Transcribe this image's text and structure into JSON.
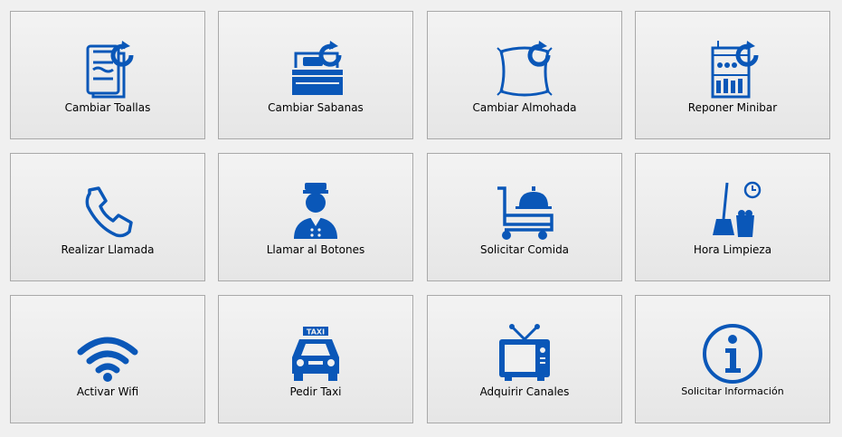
{
  "colors": {
    "icon_blue": "#0a57b8",
    "tile_border": "#a9a9a9",
    "background": "#f0f0f0"
  },
  "tiles": [
    {
      "label": "Cambiar Toallas",
      "icon": "towel-refresh-icon"
    },
    {
      "label": "Cambiar Sabanas",
      "icon": "bed-refresh-icon"
    },
    {
      "label": "Cambiar Almohada",
      "icon": "pillow-refresh-icon"
    },
    {
      "label": "Reponer Minibar",
      "icon": "minibar-refresh-icon"
    },
    {
      "label": "Realizar Llamada",
      "icon": "phone-icon"
    },
    {
      "label": "Llamar al Botones",
      "icon": "bellboy-icon"
    },
    {
      "label": "Solicitar Comida",
      "icon": "food-cart-icon"
    },
    {
      "label": "Hora Limpieza",
      "icon": "broom-clock-icon"
    },
    {
      "label": "Activar Wifi",
      "icon": "wifi-icon"
    },
    {
      "label": "Pedir Taxi",
      "icon": "taxi-icon"
    },
    {
      "label": "Adquirir Canales",
      "icon": "tv-icon"
    },
    {
      "label": "Solicitar Información",
      "icon": "info-icon"
    }
  ],
  "taxi_sign": "TAXI"
}
